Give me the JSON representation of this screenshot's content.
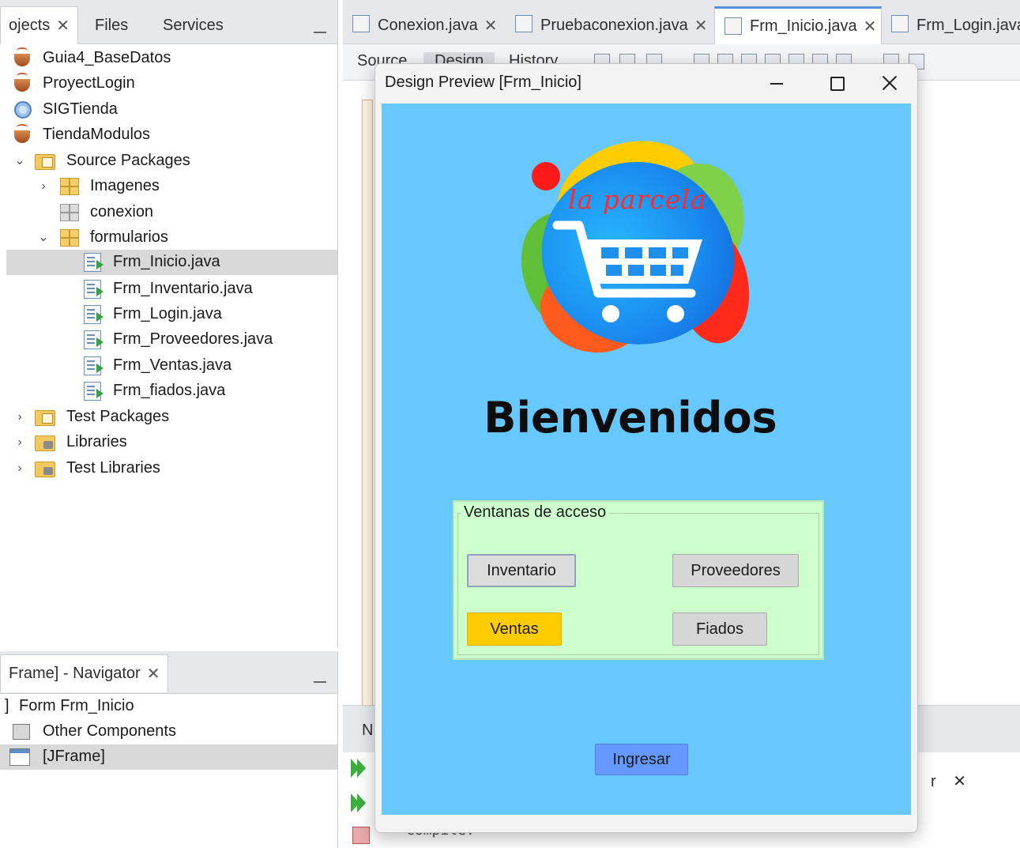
{
  "projects_panel": {
    "tabs": [
      {
        "label": "ojects",
        "closable": true,
        "active": true
      },
      {
        "label": "Files",
        "closable": false,
        "active": false
      },
      {
        "label": "Services",
        "closable": false,
        "active": false
      }
    ],
    "tree": [
      {
        "label": "Guia4_BaseDatos",
        "icon": "coffee-cup-icon",
        "depth": 0,
        "chevron": ""
      },
      {
        "label": "ProyectLogin",
        "icon": "coffee-cup-icon",
        "depth": 0,
        "chevron": ""
      },
      {
        "label": "SIGTienda",
        "icon": "globe-icon",
        "depth": 0,
        "chevron": ""
      },
      {
        "label": "TiendaModulos",
        "icon": "coffee-cup-icon",
        "depth": 0,
        "chevron": ""
      },
      {
        "label": "Source Packages",
        "icon": "package-folder-icon",
        "depth": 1,
        "chevron": "down"
      },
      {
        "label": "Imagenes",
        "icon": "package-icon",
        "depth": 2,
        "chevron": "right"
      },
      {
        "label": "conexion",
        "icon": "empty-package-icon",
        "depth": 2,
        "chevron": ""
      },
      {
        "label": "formularios",
        "icon": "package-icon",
        "depth": 2,
        "chevron": "down"
      },
      {
        "label": "Frm_Inicio.java",
        "icon": "form-file-icon",
        "depth": 3,
        "chevron": "",
        "selected": true
      },
      {
        "label": "Frm_Inventario.java",
        "icon": "form-file-icon",
        "depth": 3,
        "chevron": ""
      },
      {
        "label": "Frm_Login.java",
        "icon": "form-file-icon",
        "depth": 3,
        "chevron": ""
      },
      {
        "label": "Frm_Proveedores.java",
        "icon": "form-file-icon",
        "depth": 3,
        "chevron": ""
      },
      {
        "label": "Frm_Ventas.java",
        "icon": "form-file-icon",
        "depth": 3,
        "chevron": ""
      },
      {
        "label": "Frm_fiados.java",
        "icon": "form-file-icon",
        "depth": 3,
        "chevron": ""
      },
      {
        "label": "Test Packages",
        "icon": "package-folder-icon",
        "depth": 1,
        "chevron": "right"
      },
      {
        "label": "Libraries",
        "icon": "library-folder-icon",
        "depth": 1,
        "chevron": "right"
      },
      {
        "label": "Test Libraries",
        "icon": "library-folder-icon",
        "depth": 1,
        "chevron": "right"
      }
    ]
  },
  "navigator": {
    "tab_label": "Frame] - Navigator",
    "items": [
      {
        "label": "Form Frm_Inicio",
        "icon": ""
      },
      {
        "label": "Other Components",
        "icon": "components-icon"
      },
      {
        "label": "[JFrame]",
        "icon": "jframe-icon",
        "selected": true
      }
    ]
  },
  "editor": {
    "tabs": [
      {
        "label": "Conexion.java",
        "active": false
      },
      {
        "label": "Pruebaconexion.java",
        "active": false
      },
      {
        "label": "Frm_Inicio.java",
        "active": true
      },
      {
        "label": "Frm_Login.java",
        "active": false
      }
    ],
    "view_tabs": [
      "Source",
      "Design",
      "History"
    ],
    "output_tab": "N",
    "right_panel_label": "r",
    "output_text": "compile:"
  },
  "preview": {
    "title": "Design Preview [Frm_Inicio]",
    "logo_text": "la parcela",
    "heading": "Bienvenidos",
    "group_title": "Ventanas de acceso",
    "buttons": {
      "inventario": "Inventario",
      "proveedores": "Proveedores",
      "ventas": "Ventas",
      "fiados": "Fiados",
      "ingresar": "Ingresar"
    },
    "colors": {
      "frame_background": "#66c8fc",
      "group_background": "#ccffcc",
      "ventas_button": "#ffcc00",
      "ingresar_button": "#6699ff"
    }
  }
}
